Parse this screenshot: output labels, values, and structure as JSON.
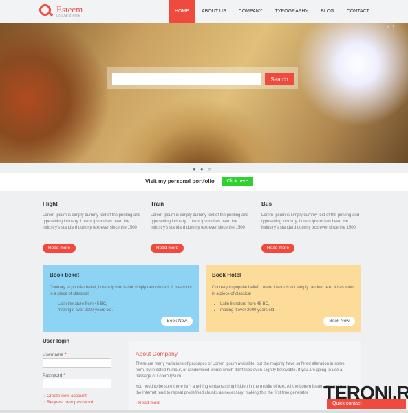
{
  "logo": {
    "name": "Esteem",
    "tagline": "drupal theme"
  },
  "nav": [
    "HOME",
    "ABOUT US",
    "COMPANY",
    "TYPOGRAPHY",
    "BLOG",
    "CONTACT"
  ],
  "hero": {
    "search_placeholder": "",
    "search_button": "Search",
    "prev": "‹",
    "next": "›",
    "dots": "●●○"
  },
  "portfolio": {
    "text": "Visit my personal portfolio",
    "button": "Click here"
  },
  "features": [
    {
      "title": "Flight",
      "text": "Lorem Ipsum is simply dummy text of the printing and typesetting industry. Lorem Ipsum has been the industry's standard dummy text ever since the 1500",
      "button": "Read more"
    },
    {
      "title": "Train",
      "text": "Lorem Ipsum is simply dummy text of the printing and typesetting industry. Lorem Ipsum has been the industry's standard dummy text ever since the 1500",
      "button": "Read more"
    },
    {
      "title": "Bus",
      "text": "Lorem Ipsum is simply dummy text of the printing and typesetting industry. Lorem Ipsum has been the industry's standard dummy text ever since the 1500",
      "button": "Read more"
    }
  ],
  "boxes": [
    {
      "title": "Book ticket",
      "text": "Contrary to popular belief, Lorem Ipsum is not simply random text. It has roots in a piece of classical",
      "items": [
        "Latin literature from 45 BC,",
        "making it over 2000 years old."
      ],
      "button": "Book Now",
      "color": "#8dd3f3"
    },
    {
      "title": "Book Hotel",
      "text": "Contrary to popular belief, Lorem Ipsum is not simply random text. It has roots in a piece of classical",
      "items": [
        "Latin literature from 45 BC,",
        "making it over 2000 years old."
      ],
      "button": "Book Now",
      "color": "#fddc9a"
    }
  ],
  "login": {
    "title": "User login",
    "username": "Username",
    "password": "Password",
    "required": "*",
    "create": "Create new account",
    "request": "Request new password"
  },
  "about": {
    "title": "About Company",
    "p1": "There are many variations of passages of Lorem Ipsum available, but the majority have suffered alteration in some form, by injected humour, or randomised words which don't look even slightly believable. If you are going to use a passage of Lorem Ipsum.",
    "p2": "You need to be sure there isn't anything embarrassing hidden in the middle of text. All the Lorem Ipsum generators on the Internet tend to repeat predefined chunks as necessary, making this the first true generator",
    "read_more": "Read more"
  },
  "quick_contact": "Quick contact",
  "watermark": "TERONI.RU",
  "accent": "#f04a3f"
}
